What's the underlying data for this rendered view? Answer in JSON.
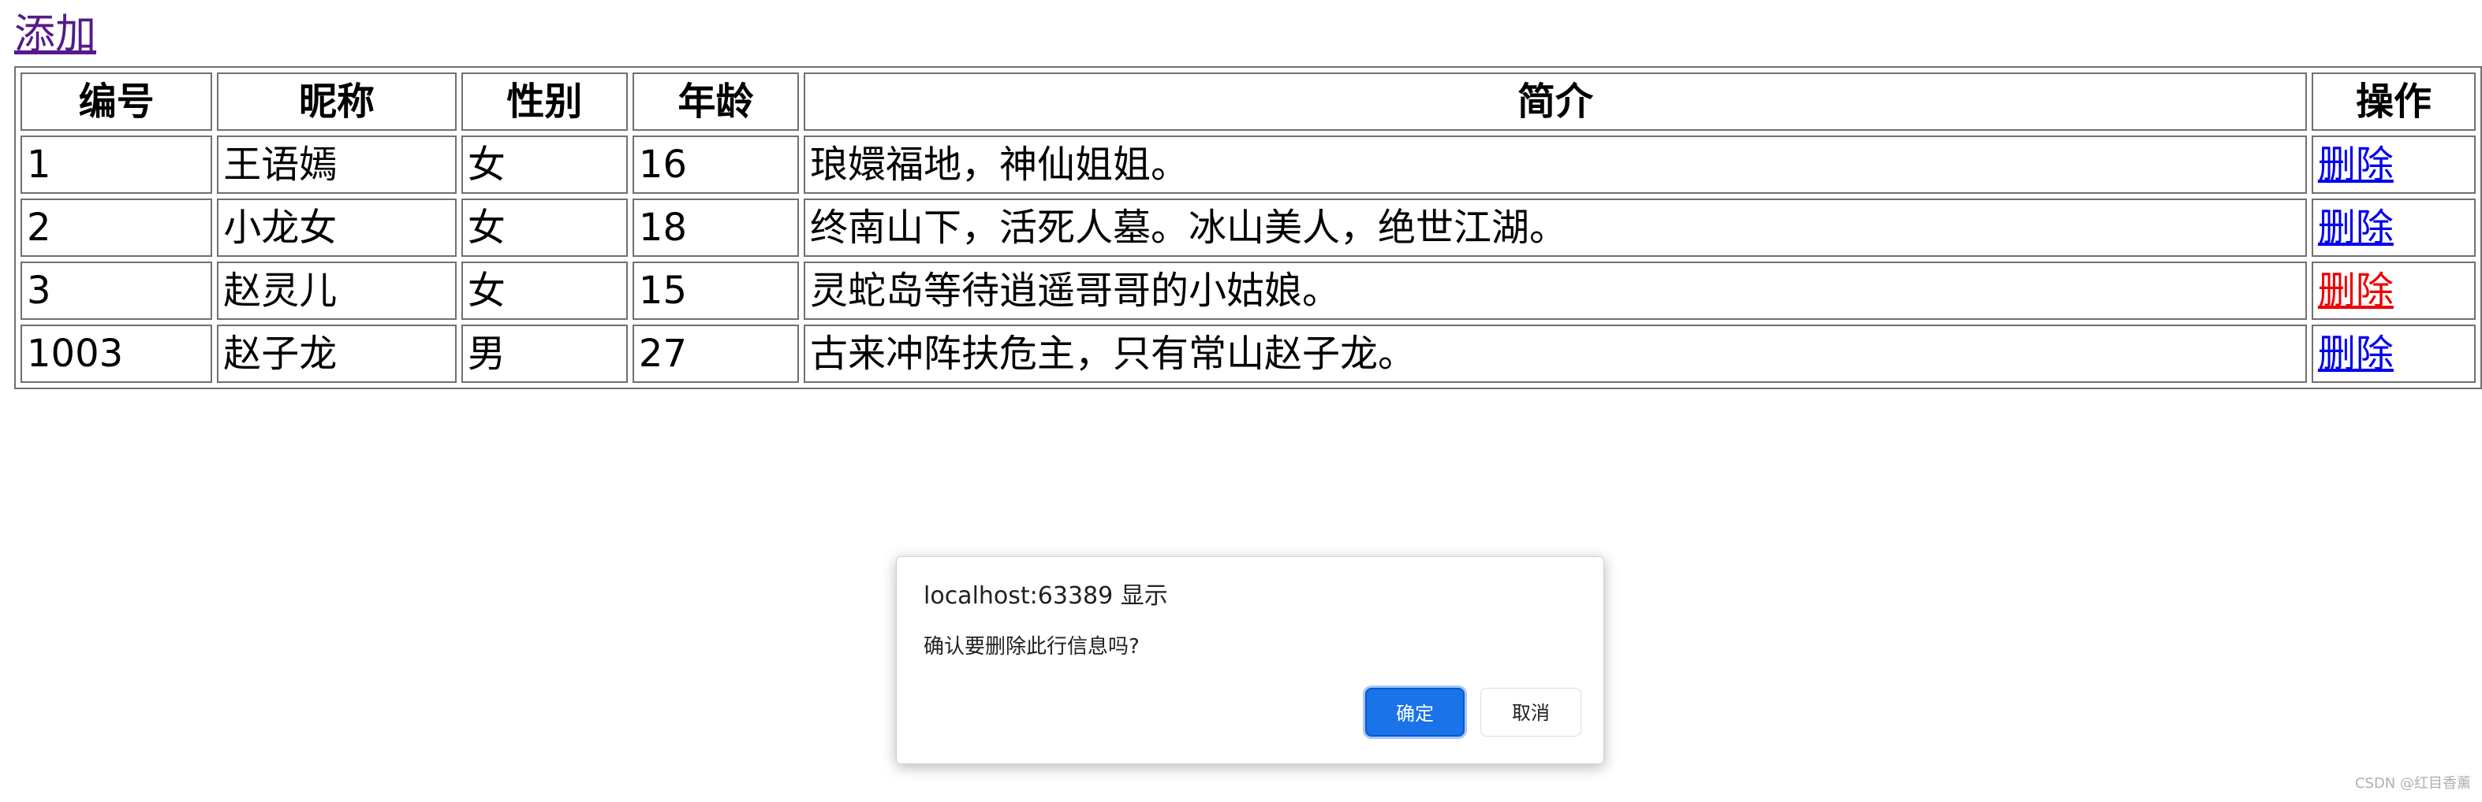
{
  "add_link_label": "添加",
  "table": {
    "headers": [
      "编号",
      "昵称",
      "性别",
      "年龄",
      "简介",
      "操作"
    ],
    "rows": [
      {
        "id": "1",
        "nickname": "王语嫣",
        "gender": "女",
        "age": "16",
        "intro": "琅嬛福地，神仙姐姐。",
        "action": "删除"
      },
      {
        "id": "2",
        "nickname": "小龙女",
        "gender": "女",
        "age": "18",
        "intro": "终南山下，活死人墓。冰山美人，绝世江湖。",
        "action": "删除"
      },
      {
        "id": "3",
        "nickname": "赵灵儿",
        "gender": "女",
        "age": "15",
        "intro": "灵蛇岛等待逍遥哥哥的小姑娘。",
        "action": "删除"
      },
      {
        "id": "1003",
        "nickname": "赵子龙",
        "gender": "男",
        "age": "27",
        "intro": "古来冲阵扶危主，只有常山赵子龙。",
        "action": "删除"
      }
    ]
  },
  "dialog": {
    "origin": "localhost:63389 显示",
    "message": "确认要删除此行信息吗?",
    "ok_label": "确定",
    "cancel_label": "取消"
  },
  "watermark": "CSDN @红目香薰",
  "colors": {
    "link": "#0000ee",
    "visited_link": "#551a8b",
    "active_link": "#ee0000",
    "ok_button": "#1a73e8"
  }
}
